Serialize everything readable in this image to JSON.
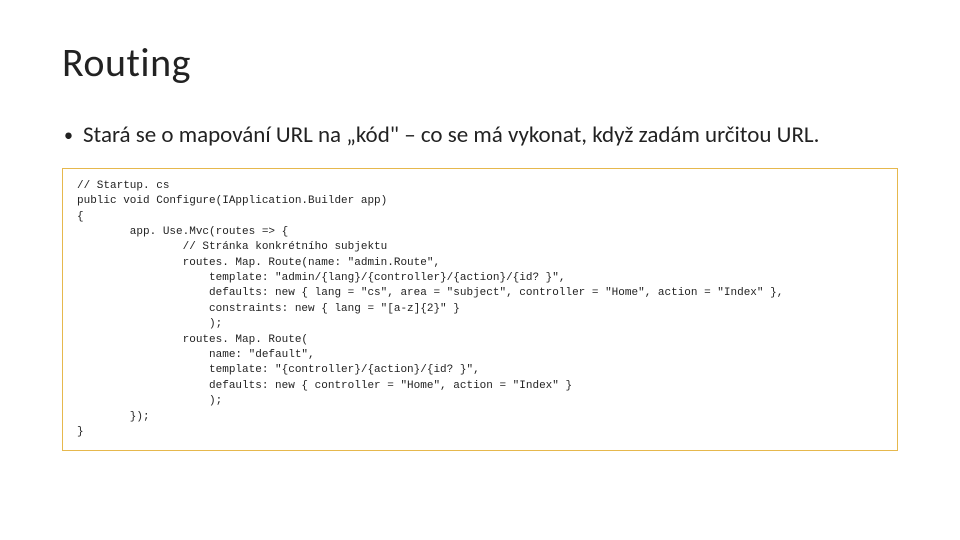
{
  "title": "Routing",
  "bullet_text": "Stará se o mapování URL na „kód\" – co se má vykonat, když zadám určitou URL.",
  "code": "// Startup. cs\npublic void Configure(IApplication.Builder app)\n{\n        app. Use.Mvc(routes => {\n                // Stránka konkrétního subjektu\n                routes. Map. Route(name: \"admin.Route\",\n                    template: \"admin/{lang}/{controller}/{action}/{id? }\",\n                    defaults: new { lang = \"cs\", area = \"subject\", controller = \"Home\", action = \"Index\" },\n                    constraints: new { lang = \"[a-z]{2}\" }\n                    );\n                routes. Map. Route(\n                    name: \"default\",\n                    template: \"{controller}/{action}/{id? }\",\n                    defaults: new { controller = \"Home\", action = \"Index\" }\n                    );\n        });\n}"
}
